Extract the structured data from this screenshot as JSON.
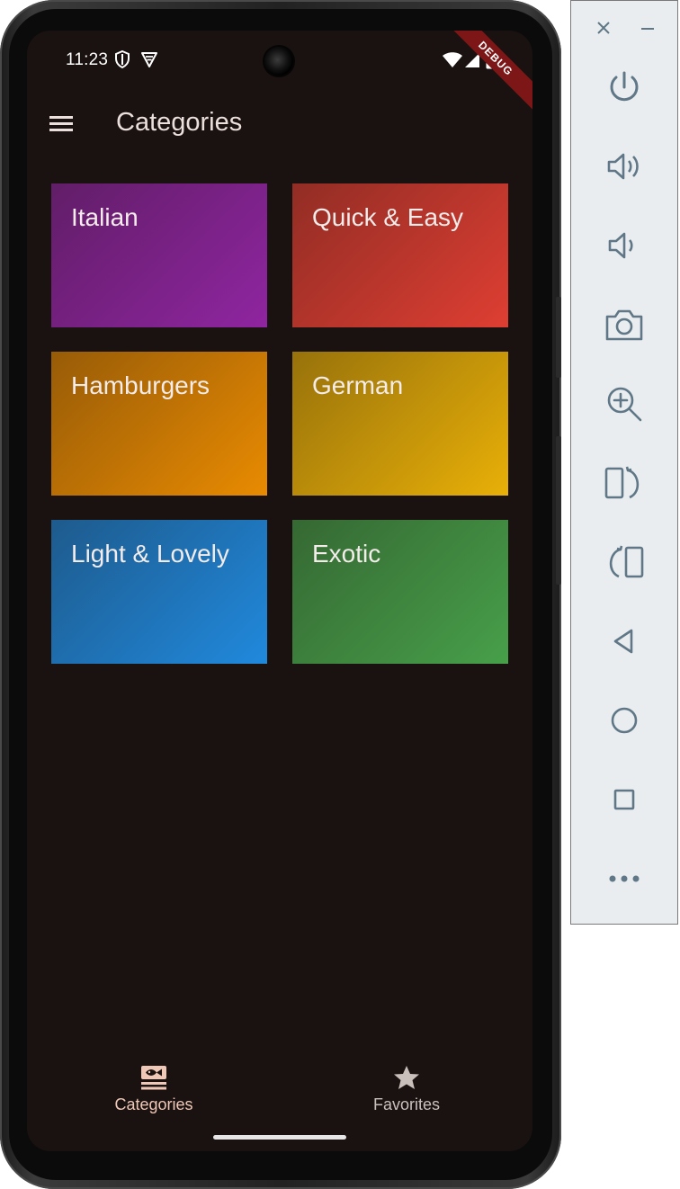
{
  "status_bar": {
    "time": "11:23",
    "icons": [
      "shield-icon",
      "vpn-shield-icon",
      "wifi-icon",
      "cell-signal-icon",
      "battery-icon"
    ],
    "debug_banner": "DEBUG"
  },
  "app_bar": {
    "menu_icon": "hamburger-menu-icon",
    "title": "Categories"
  },
  "categories": [
    {
      "label": "Italian",
      "color": "#9c27b0"
    },
    {
      "label": "Quick & Easy",
      "color": "#f44336"
    },
    {
      "label": "Hamburgers",
      "color": "#ff9800"
    },
    {
      "label": "German",
      "color": "#ffc107"
    },
    {
      "label": "Light & Lovely",
      "color": "#2196f3"
    },
    {
      "label": "Exotic",
      "color": "#4caf50"
    }
  ],
  "bottom_nav": {
    "items": [
      {
        "label": "Categories",
        "icon": "set-meal-icon",
        "selected": true
      },
      {
        "label": "Favorites",
        "icon": "star-icon",
        "selected": false
      }
    ],
    "selected_color": "#f0c8b8",
    "unselected_color": "#c9c0bc"
  },
  "emulator_toolbar": {
    "window_buttons": [
      "close-icon",
      "minimize-icon"
    ],
    "buttons": [
      "power-icon",
      "volume-up-icon",
      "volume-down-icon",
      "camera-icon",
      "zoom-in-icon",
      "rotate-left-icon",
      "rotate-right-icon",
      "back-icon",
      "home-icon",
      "overview-icon",
      "more-icon"
    ],
    "icon_color": "#5f7786"
  },
  "colors": {
    "screen_background": "#1a1210",
    "title_text": "#ece0dc"
  }
}
